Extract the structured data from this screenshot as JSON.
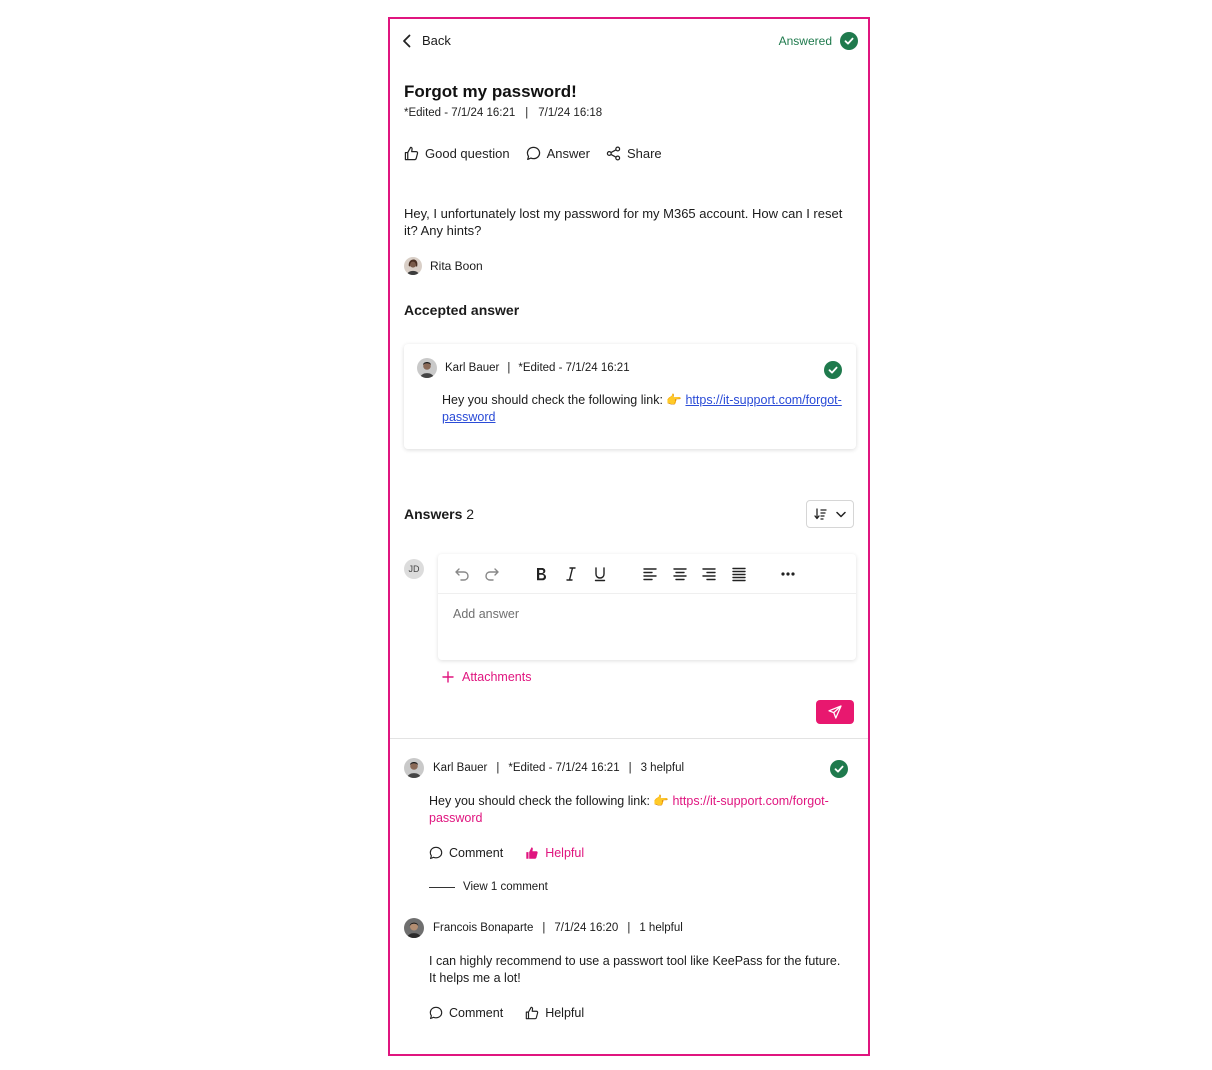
{
  "header": {
    "back_label": "Back",
    "status_label": "Answered",
    "status_color": "#1f7a4d"
  },
  "question": {
    "title": "Forgot my password!",
    "edited": "*Edited - 7/1/24 16:21",
    "created": "7/1/24 16:18",
    "body": "Hey, I unfortunately lost my password for my M365 account. How can I reset it? Any hints?",
    "author": "Rita Boon",
    "actions": {
      "good_question": "Good question",
      "answer": "Answer",
      "share": "Share"
    }
  },
  "accepted": {
    "heading": "Accepted answer",
    "author": "Karl Bauer",
    "edited": "*Edited - 7/1/24 16:21",
    "text": "Hey you should check the following link: 👉 ",
    "link": "https://it-support.com/forgot-password"
  },
  "answers_section": {
    "heading": "Answers",
    "count": "2",
    "user_initials": "JD",
    "editor_placeholder": "Add answer",
    "attachments_label": "Attachments",
    "toolbar_icons": [
      "undo-icon",
      "redo-icon",
      "bold-icon",
      "italic-icon",
      "underline-icon",
      "align-left-icon",
      "align-center-icon",
      "align-right-icon",
      "align-justify-icon",
      "more-icon"
    ]
  },
  "answers": [
    {
      "author": "Karl Bauer",
      "edited": "*Edited - 7/1/24 16:21",
      "helpful_count": "3 helpful",
      "text": "Hey you should check the following link: 👉 ",
      "link": "https://it-support.com/forgot-password",
      "comment_label": "Comment",
      "helpful_label": "Helpful",
      "view_comments": "View 1 comment",
      "accepted": true
    },
    {
      "author": "Francois Bonaparte",
      "date": "7/1/24 16:20",
      "helpful_count": "1 helpful",
      "text": "I can highly recommend to use a passwort tool like KeePass for the future. It helps me a lot!",
      "comment_label": "Comment",
      "helpful_label": "Helpful"
    }
  ],
  "colors": {
    "accent": "#e0157f",
    "success": "#1f7a4d",
    "link_blue": "#2a4bd7"
  }
}
